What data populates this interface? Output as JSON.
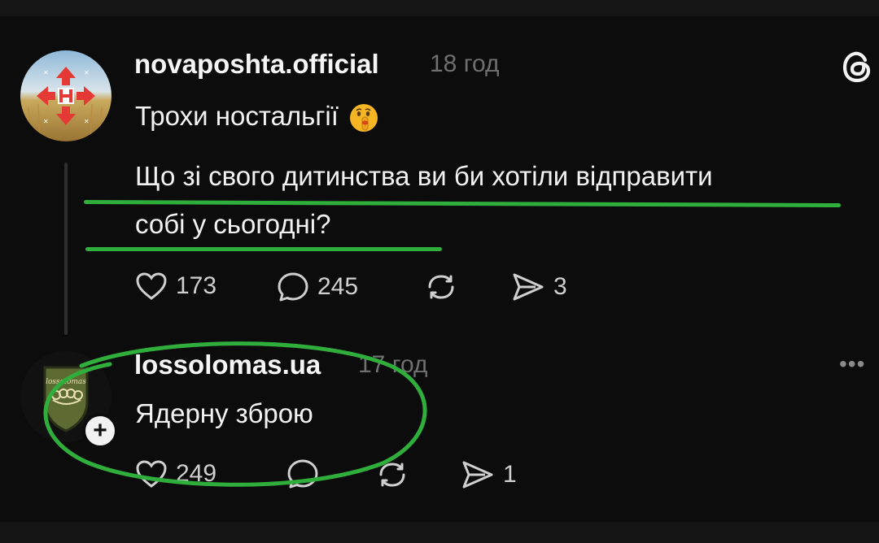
{
  "post1": {
    "username": "novaposhta.official",
    "time": "18 год",
    "text_line1": "Трохи ностальгії",
    "text_line2": "Що зі свого дитинства ви би хотіли відправити",
    "text_line3": "собі у сьогодні?",
    "likes": "173",
    "comments": "245",
    "shares": "3",
    "emoji": "shushing-face-emoji"
  },
  "post2": {
    "username": "lossolomas.ua",
    "time": "17 год",
    "text_line1": "Ядерну зброю",
    "likes": "249",
    "shares": "1",
    "more": "•••"
  },
  "colors": {
    "background": "#0c0c0c",
    "highlight": "#2fae3c",
    "muted": "#6f6f6f"
  }
}
